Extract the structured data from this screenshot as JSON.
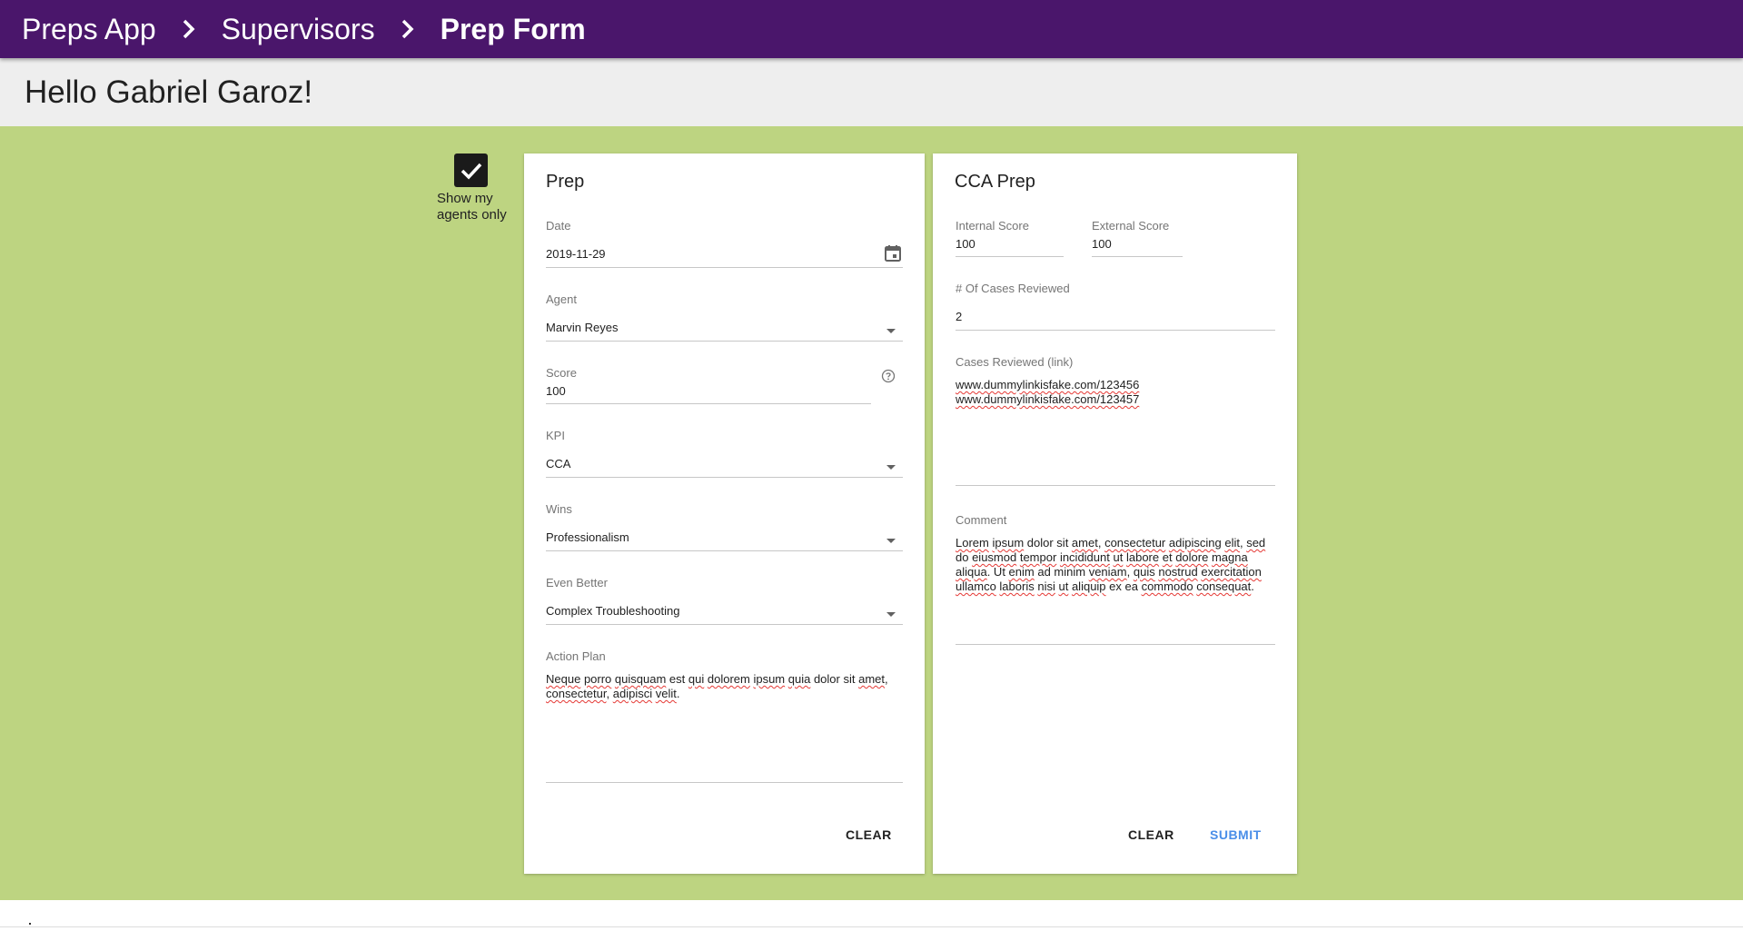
{
  "appbar": {
    "breadcrumbs": [
      "Preps App",
      "Supervisors",
      "Prep Form"
    ],
    "background": "#4a166b"
  },
  "greeting": "Hello Gabriel Garoz!",
  "filter": {
    "label": "Show my agents only",
    "checked": true
  },
  "prep_card": {
    "title": "Prep",
    "date": {
      "label": "Date",
      "value": "2019-11-29",
      "icon": "calendar-icon"
    },
    "agent": {
      "label": "Agent",
      "value": "Marvin Reyes"
    },
    "score": {
      "label": "Score",
      "value": "100",
      "icon": "help-circle-icon"
    },
    "kpi": {
      "label": "KPI",
      "value": "CCA"
    },
    "wins": {
      "label": "Wins",
      "value": "Professionalism"
    },
    "even_better": {
      "label": "Even Better",
      "value": "Complex Troubleshooting"
    },
    "action_plan": {
      "label": "Action Plan",
      "value": "Neque porro quisquam est qui dolorem ipsum quia dolor sit amet, consectetur, adipisci velit."
    },
    "clear_label": "CLEAR"
  },
  "cca_card": {
    "title": "CCA Prep",
    "internal_score": {
      "label": "Internal Score",
      "value": "100"
    },
    "external_score": {
      "label": "External Score",
      "value": "100"
    },
    "cases_reviewed": {
      "label": "# Of Cases Reviewed",
      "value": "2"
    },
    "cases_links": {
      "label": "Cases Reviewed (link)",
      "lines": [
        "www.dummylinkisfake.com/123456",
        "www.dummylinkisfake.com/123457"
      ]
    },
    "comment": {
      "label": "Comment",
      "value": "Lorem ipsum dolor sit amet, consectetur adipiscing elit, sed do eiusmod tempor incididunt ut labore et dolore magna aliqua. Ut enim ad minim veniam, quis nostrud exercitation ullamco laboris nisi ut aliquip ex ea commodo consequat."
    },
    "clear_label": "CLEAR",
    "submit_label": "SUBMIT"
  },
  "colors": {
    "background": "#bdd481",
    "accent": "#4a8ee8"
  }
}
